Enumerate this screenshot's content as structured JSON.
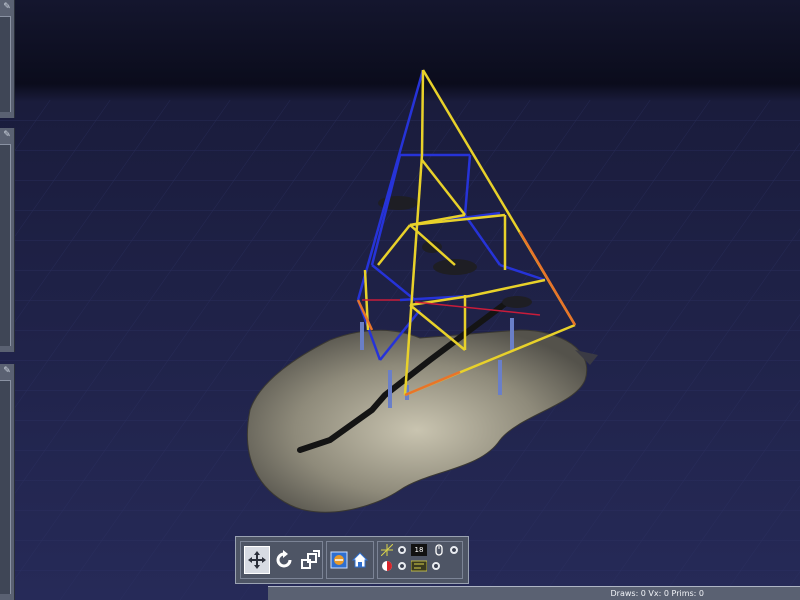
{
  "status": {
    "stats": "Draws: 0 Vx: 0 Prims: 0"
  },
  "toolbar": {
    "speed_value": "18"
  },
  "icons": {
    "panel_pin": "pin-icon",
    "move": "move-arrows-icon",
    "rotate": "rotate-icon",
    "scale": "scale-icon",
    "view_cube": "view-cube-icon",
    "home": "home-icon",
    "grid": "grid-icon",
    "mouse": "mouse-icon",
    "color_wheel": "color-wheel-icon",
    "time": "time-icon"
  },
  "colors": {
    "sky": "#0f1129",
    "panel": "#5a6172",
    "toolbar": "#4e5565",
    "frame_yellow": "#e8d12a",
    "frame_blue": "#2633d8",
    "frame_orange": "#e8742a"
  }
}
